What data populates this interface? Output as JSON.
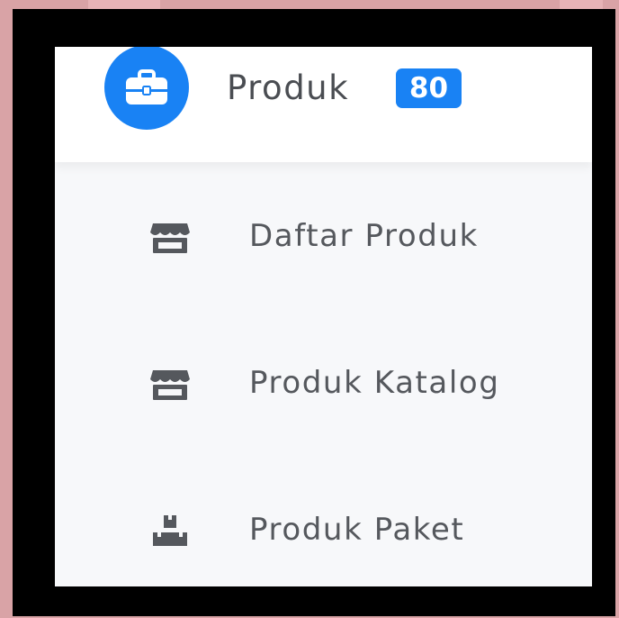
{
  "menu": {
    "title": "Produk",
    "badge_count": "80",
    "header_icon": "briefcase-icon",
    "items": [
      {
        "label": "Daftar Produk",
        "icon": "store-icon"
      },
      {
        "label": "Produk Katalog",
        "icon": "store-icon"
      },
      {
        "label": "Produk Paket",
        "icon": "boxes-icon"
      }
    ]
  },
  "colors": {
    "accent": "#1982f4",
    "text": "#4a4d52",
    "submenu_bg": "#f7f8fa",
    "frame": "#000000",
    "backdrop": "#d9a3a6"
  }
}
